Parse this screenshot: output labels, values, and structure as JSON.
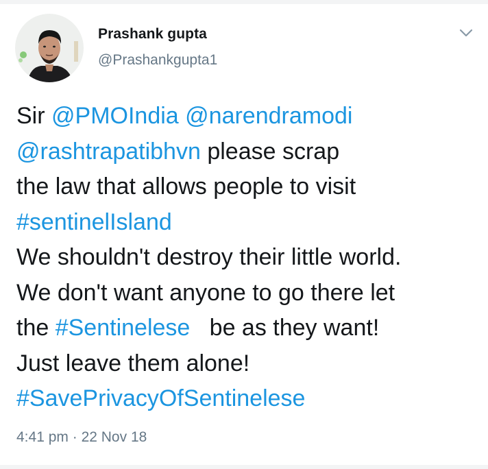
{
  "author": {
    "display_name": "Prashank gupta",
    "handle": "@Prashankgupta1"
  },
  "tweet": {
    "lines": [
      [
        {
          "text": "Sir ",
          "type": "text"
        },
        {
          "text": "@PMOIndia",
          "type": "mention"
        },
        {
          "text": " ",
          "type": "text"
        },
        {
          "text": "@narendramodi",
          "type": "mention"
        }
      ],
      [
        {
          "text": "@rashtrapatibhvn",
          "type": "mention"
        },
        {
          "text": " please scrap",
          "type": "text"
        }
      ],
      [
        {
          "text": "the law that allows people to visit",
          "type": "text"
        }
      ],
      [
        {
          "text": "#sentinelIsland",
          "type": "hashtag"
        }
      ],
      [
        {
          "text": "We shouldn't destroy their little world.",
          "type": "text"
        }
      ],
      [
        {
          "text": "We don't want anyone to go there let",
          "type": "text"
        }
      ],
      [
        {
          "text": "the ",
          "type": "text"
        },
        {
          "text": "#Sentinelese",
          "type": "hashtag"
        },
        {
          "text": "   be as they want!",
          "type": "text"
        }
      ],
      [
        {
          "text": "Just leave them alone!",
          "type": "text"
        }
      ],
      [
        {
          "text": "#SavePrivacyOfSentinelese",
          "type": "hashtag"
        }
      ]
    ],
    "time": "4:41 pm",
    "separator": "·",
    "date": "22 Nov 18"
  },
  "icons": {
    "menu": "chevron-down-icon",
    "avatar": "profile-photo"
  },
  "colors": {
    "link": "#1b95e0",
    "text": "#14171a",
    "secondary": "#657786"
  }
}
